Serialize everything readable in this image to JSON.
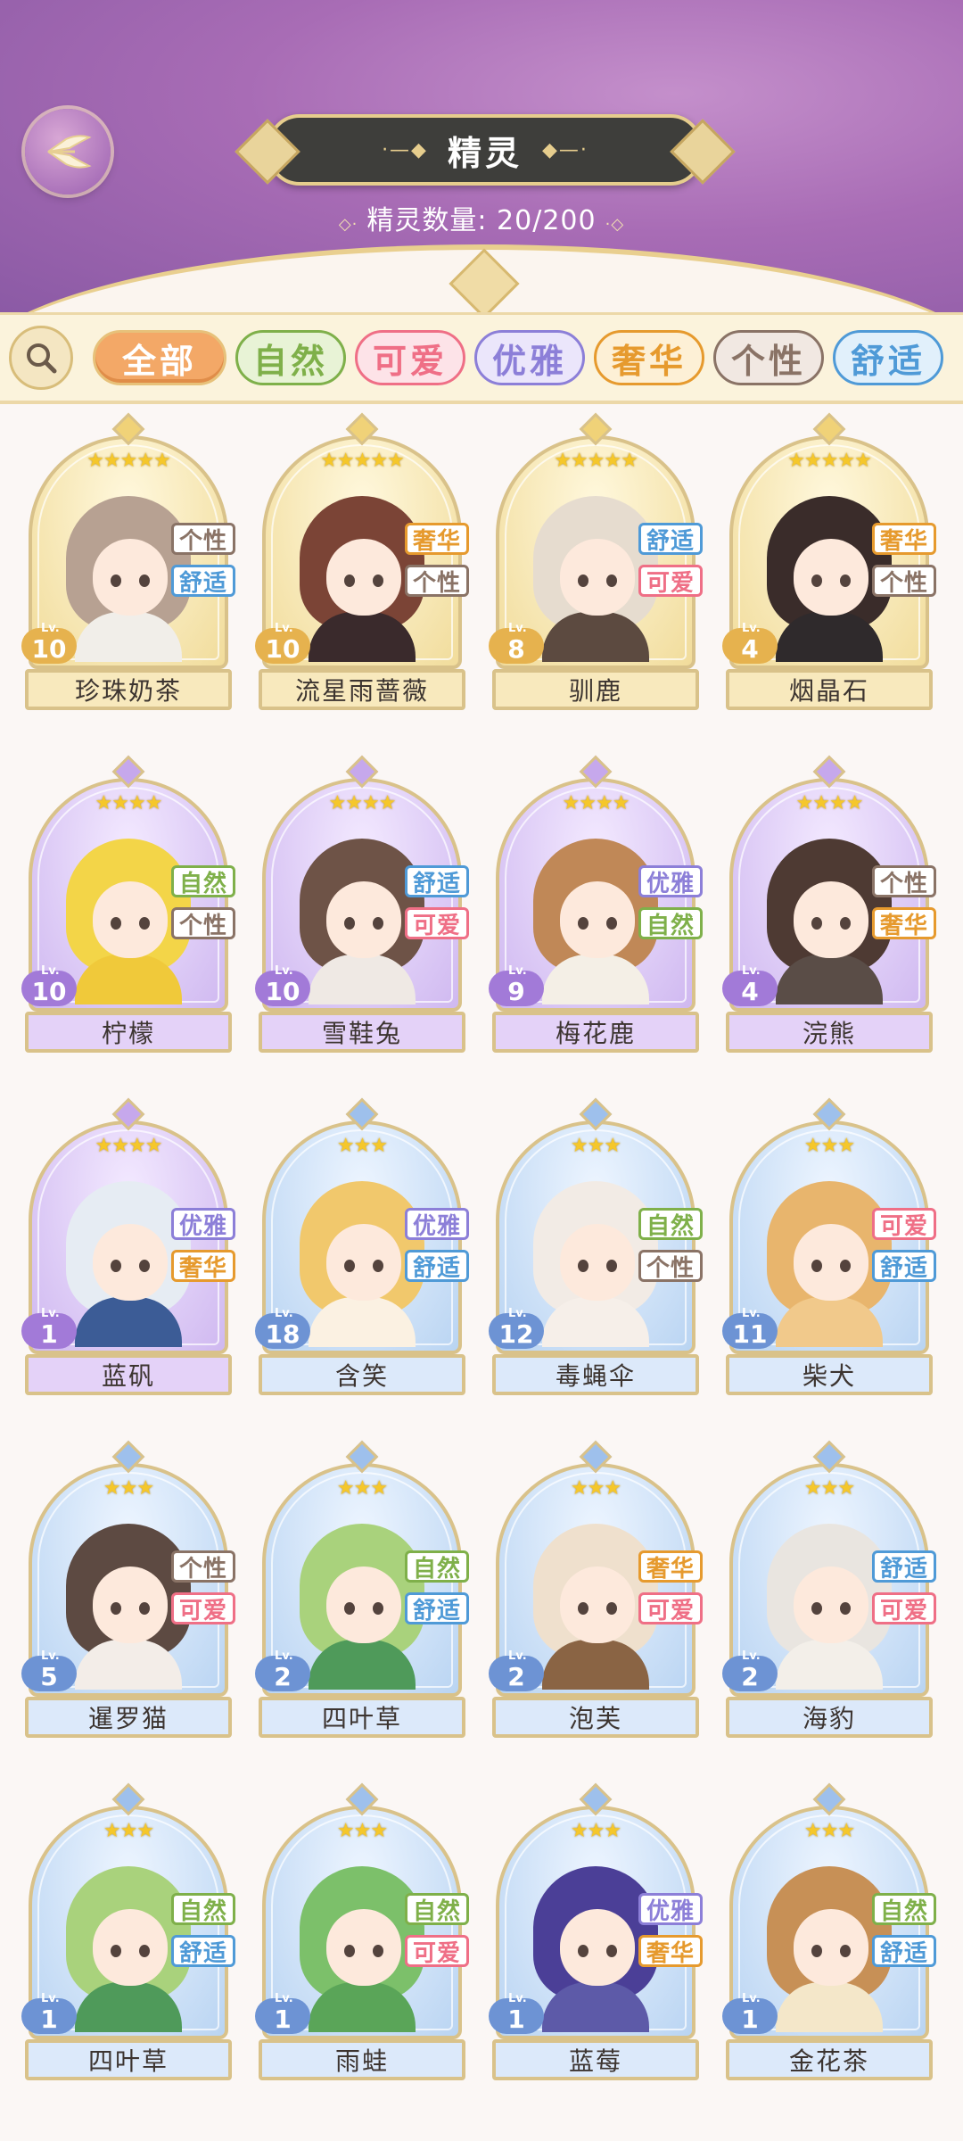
{
  "header": {
    "title": "精灵",
    "count_label": "精灵数量:",
    "count_value": "20/200"
  },
  "filters": [
    {
      "label": "全部",
      "active": true,
      "color": "#f3a867",
      "bg": "#f3a867"
    },
    {
      "label": "自然",
      "active": false,
      "color": "#7fb04a",
      "bg": "#e8f3d6"
    },
    {
      "label": "可爱",
      "active": false,
      "color": "#ef6f86",
      "bg": "#fde3e8"
    },
    {
      "label": "优雅",
      "active": false,
      "color": "#8c7fd8",
      "bg": "#ebe6fb"
    },
    {
      "label": "奢华",
      "active": false,
      "color": "#e69a2e",
      "bg": "#fdf0d6"
    },
    {
      "label": "个性",
      "active": false,
      "color": "#8a7366",
      "bg": "#f1e8e2"
    },
    {
      "label": "舒适",
      "active": false,
      "color": "#4f9ad7",
      "bg": "#e1f0fb"
    }
  ],
  "trait_colors": {
    "自然": "#7fb04a",
    "可爱": "#ef6f86",
    "优雅": "#8c7fd8",
    "奢华": "#e69a2e",
    "个性": "#8a7366",
    "舒适": "#4f9ad7"
  },
  "spirits": [
    {
      "name": "珍珠奶茶",
      "level": "10",
      "stars": 5,
      "tier": "gold",
      "traits": [
        "个性",
        "舒适"
      ],
      "hair": "#b7a192",
      "body": "#f1eee9"
    },
    {
      "name": "流星雨蔷薇",
      "level": "10",
      "stars": 5,
      "tier": "gold",
      "traits": [
        "奢华",
        "个性"
      ],
      "hair": "#7b4436",
      "body": "#3a2a2c"
    },
    {
      "name": "驯鹿",
      "level": "8",
      "stars": 5,
      "tier": "gold",
      "traits": [
        "舒适",
        "可爱"
      ],
      "hair": "#e6dccf",
      "body": "#5c4a40"
    },
    {
      "name": "烟晶石",
      "level": "4",
      "stars": 5,
      "tier": "gold",
      "traits": [
        "奢华",
        "个性"
      ],
      "hair": "#3a2c2a",
      "body": "#2f2a2c"
    },
    {
      "name": "柠檬",
      "level": "10",
      "stars": 4,
      "tier": "purple",
      "traits": [
        "自然",
        "个性"
      ],
      "hair": "#f3d548",
      "body": "#f0c93a"
    },
    {
      "name": "雪鞋兔",
      "level": "10",
      "stars": 4,
      "tier": "purple",
      "traits": [
        "舒适",
        "可爱"
      ],
      "hair": "#6e5347",
      "body": "#efe9e4"
    },
    {
      "name": "梅花鹿",
      "level": "9",
      "stars": 4,
      "tier": "purple",
      "traits": [
        "优雅",
        "自然"
      ],
      "hair": "#c08857",
      "body": "#f4efe6"
    },
    {
      "name": "浣熊",
      "level": "4",
      "stars": 4,
      "tier": "purple",
      "traits": [
        "个性",
        "奢华"
      ],
      "hair": "#4e3a33",
      "body": "#5a4d47"
    },
    {
      "name": "蓝矾",
      "level": "1",
      "stars": 4,
      "tier": "purple",
      "traits": [
        "优雅",
        "奢华"
      ],
      "hair": "#e6ecf3",
      "body": "#3c5c96"
    },
    {
      "name": "含笑",
      "level": "18",
      "stars": 3,
      "tier": "blue",
      "traits": [
        "优雅",
        "舒适"
      ],
      "hair": "#f1c86c",
      "body": "#fbf1e2"
    },
    {
      "name": "毒蝇伞",
      "level": "12",
      "stars": 3,
      "tier": "blue",
      "traits": [
        "自然",
        "个性"
      ],
      "hair": "#f2ebe5",
      "body": "#f6efe9"
    },
    {
      "name": "柴犬",
      "level": "11",
      "stars": 3,
      "tier": "blue",
      "traits": [
        "可爱",
        "舒适"
      ],
      "hair": "#e8b56d",
      "body": "#f1c98b"
    },
    {
      "name": "暹罗猫",
      "level": "5",
      "stars": 3,
      "tier": "blue",
      "traits": [
        "个性",
        "可爱"
      ],
      "hair": "#5d4a42",
      "body": "#f3ede8"
    },
    {
      "name": "四叶草",
      "level": "2",
      "stars": 3,
      "tier": "blue",
      "traits": [
        "自然",
        "舒适"
      ],
      "hair": "#a9d27c",
      "body": "#4f9a5a"
    },
    {
      "name": "泡芙",
      "level": "2",
      "stars": 3,
      "tier": "blue",
      "traits": [
        "奢华",
        "可爱"
      ],
      "hair": "#efe0cd",
      "body": "#8a6444"
    },
    {
      "name": "海豹",
      "level": "2",
      "stars": 3,
      "tier": "blue",
      "traits": [
        "舒适",
        "可爱"
      ],
      "hair": "#e9e5e0",
      "body": "#f3efe9"
    },
    {
      "name": "四叶草",
      "level": "1",
      "stars": 3,
      "tier": "blue",
      "traits": [
        "自然",
        "舒适"
      ],
      "hair": "#a9d27c",
      "body": "#4f9a5a"
    },
    {
      "name": "雨蛙",
      "level": "1",
      "stars": 3,
      "tier": "blue",
      "traits": [
        "自然",
        "可爱"
      ],
      "hair": "#7cc06a",
      "body": "#5aa558"
    },
    {
      "name": "蓝莓",
      "level": "1",
      "stars": 3,
      "tier": "blue",
      "traits": [
        "优雅",
        "奢华"
      ],
      "hair": "#4b3f97",
      "body": "#5d5aa8"
    },
    {
      "name": "金花茶",
      "level": "1",
      "stars": 3,
      "tier": "blue",
      "traits": [
        "自然",
        "舒适"
      ],
      "hair": "#c79056",
      "body": "#f4e7c9"
    }
  ],
  "icons": {
    "back": "back-wing-icon",
    "search": "search-icon",
    "star": "★"
  }
}
